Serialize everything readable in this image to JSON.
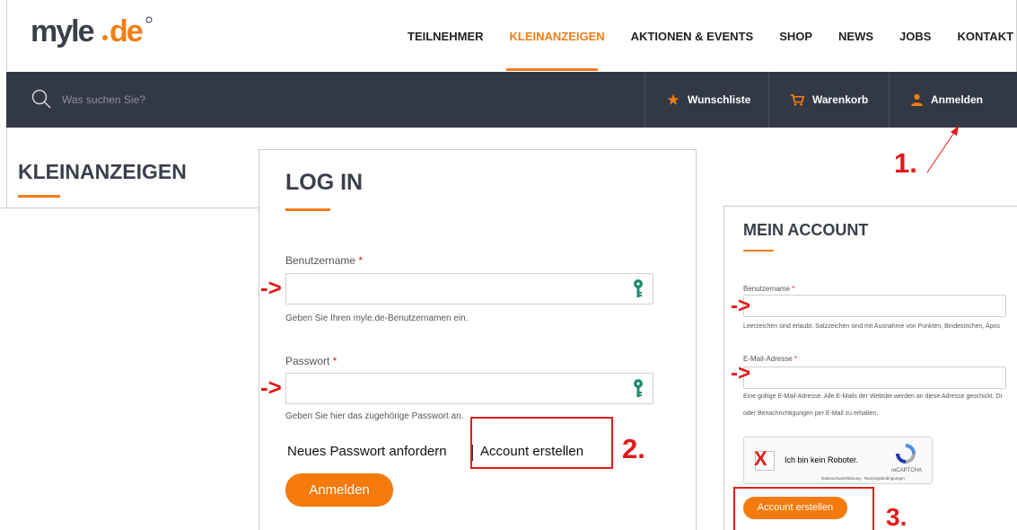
{
  "brand": {
    "logo_text": "myle.de",
    "accent": "#f07d14"
  },
  "nav": {
    "items": [
      "TEILNEHMER",
      "KLEINANZEIGEN",
      "AKTIONEN & EVENTS",
      "SHOP",
      "NEWS",
      "JOBS",
      "KONTAKT"
    ],
    "active": "KLEINANZEIGEN"
  },
  "searchbar": {
    "placeholder": "Was suchen Sie?",
    "wishlist": "Wunschliste",
    "cart": "Warenkorb",
    "login": "Anmelden"
  },
  "section_title": "KLEINANZEIGEN",
  "login_panel": {
    "title": "LOG IN",
    "username_label": "Benutzername",
    "username_hint": "Geben Sie Ihren myle.de-Benutzernamen ein.",
    "password_label": "Passwort",
    "password_hint": "Geben Sie hier das zugehörige Passwort an.",
    "required_mark": "*",
    "request_password": "Neues Passwort anfordern",
    "create_account": "Account erstellen",
    "submit": "Anmelden"
  },
  "account_panel": {
    "title": "MEIN ACCOUNT",
    "username_label": "Benutzername",
    "username_hint": "Leerzeichen sind erlaubt. Satzzeichen sind mit Ausnahme von Punkten, Bindestrichen, Apos",
    "email_label": "E-Mail-Adresse",
    "email_hint_1": "Eine gültige E-Mail-Adresse. Alle E-Mails der Website werden an diese Adresse geschickt. Di",
    "email_hint_2": "oder Benachrichtigungen per E-Mail zu erhalten.",
    "required_mark": "*",
    "captcha_text": "Ich bin kein Roboter.",
    "captcha_brand": "reCAPTCHA",
    "captcha_links": "Datenschutzerklärung - Nutzungsbedingungen",
    "submit": "Account erstellen"
  },
  "annotations": {
    "arrow": "->",
    "step1": "1.",
    "step2": "2.",
    "step3": "3.",
    "check_mark": "X",
    "color": "#e21a1a"
  }
}
